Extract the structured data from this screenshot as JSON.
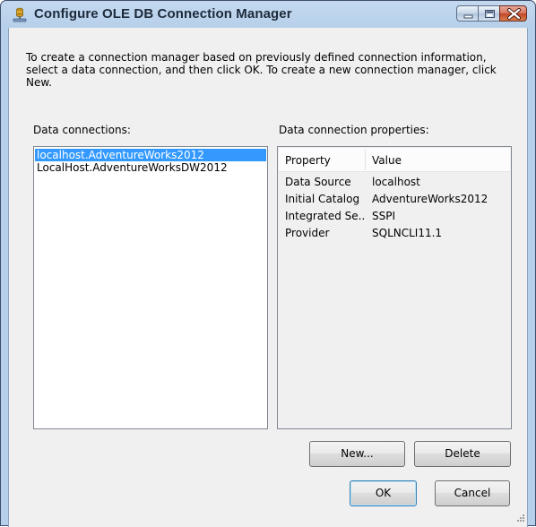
{
  "window": {
    "title": "Configure OLE DB Connection Manager",
    "title_icon": "connection-manager-icon",
    "controls": [
      "minimize-icon",
      "maximize-icon",
      "close-icon"
    ]
  },
  "description": "To create a connection manager based on previously defined connection information, select a data connection, and then click OK. To create a new connection manager, click New.",
  "data_connections": {
    "label": "Data connections:",
    "items": [
      "localhost.AdventureWorks2012",
      "LocalHost.AdventureWorksDW2012"
    ],
    "selected_index": 0
  },
  "properties": {
    "label": "Data connection properties:",
    "header_property": "Property",
    "header_value": "Value",
    "rows": [
      {
        "name": "Data Source",
        "value": "localhost"
      },
      {
        "name": "Initial Catalog",
        "value": "AdventureWorks2012"
      },
      {
        "name": "Integrated Se...",
        "value": "SSPI"
      },
      {
        "name": "Provider",
        "value": "SQLNCLI11.1"
      }
    ]
  },
  "buttons": {
    "new": "New...",
    "delete": "Delete",
    "ok": "OK",
    "cancel": "Cancel"
  },
  "colors": {
    "selection": "#3399ff",
    "title_bar": "#b6cfea",
    "close_button": "#c04527"
  }
}
